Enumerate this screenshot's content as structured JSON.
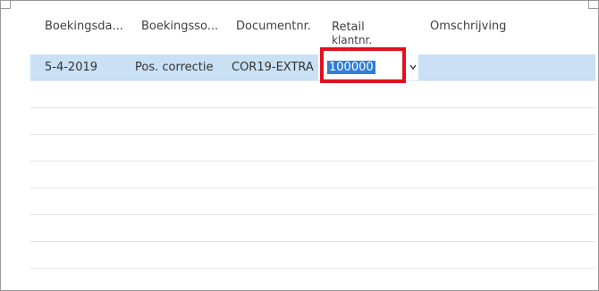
{
  "table": {
    "columns": [
      {
        "label": "Boekingsda..."
      },
      {
        "label": "Boekingsso..."
      },
      {
        "label": "Documentnr."
      },
      {
        "label_line1": "Retail",
        "label_line2": "klantnr."
      },
      {
        "label": "Omschrijving"
      }
    ],
    "rows": [
      {
        "selected": true,
        "boekingsdatum": "5-4-2019",
        "boekingssoort": "Pos. correctie",
        "documentnr": "COR19-EXTRA",
        "retail_klantnr": "100000",
        "omschrijving": ""
      }
    ],
    "empty_row_count": 6
  },
  "colors": {
    "selection": "#c9e0f5",
    "text_selection": "#2f7fd6",
    "highlight_box": "#e3101c"
  },
  "icons": {
    "lookup": "chevron-down-icon"
  }
}
